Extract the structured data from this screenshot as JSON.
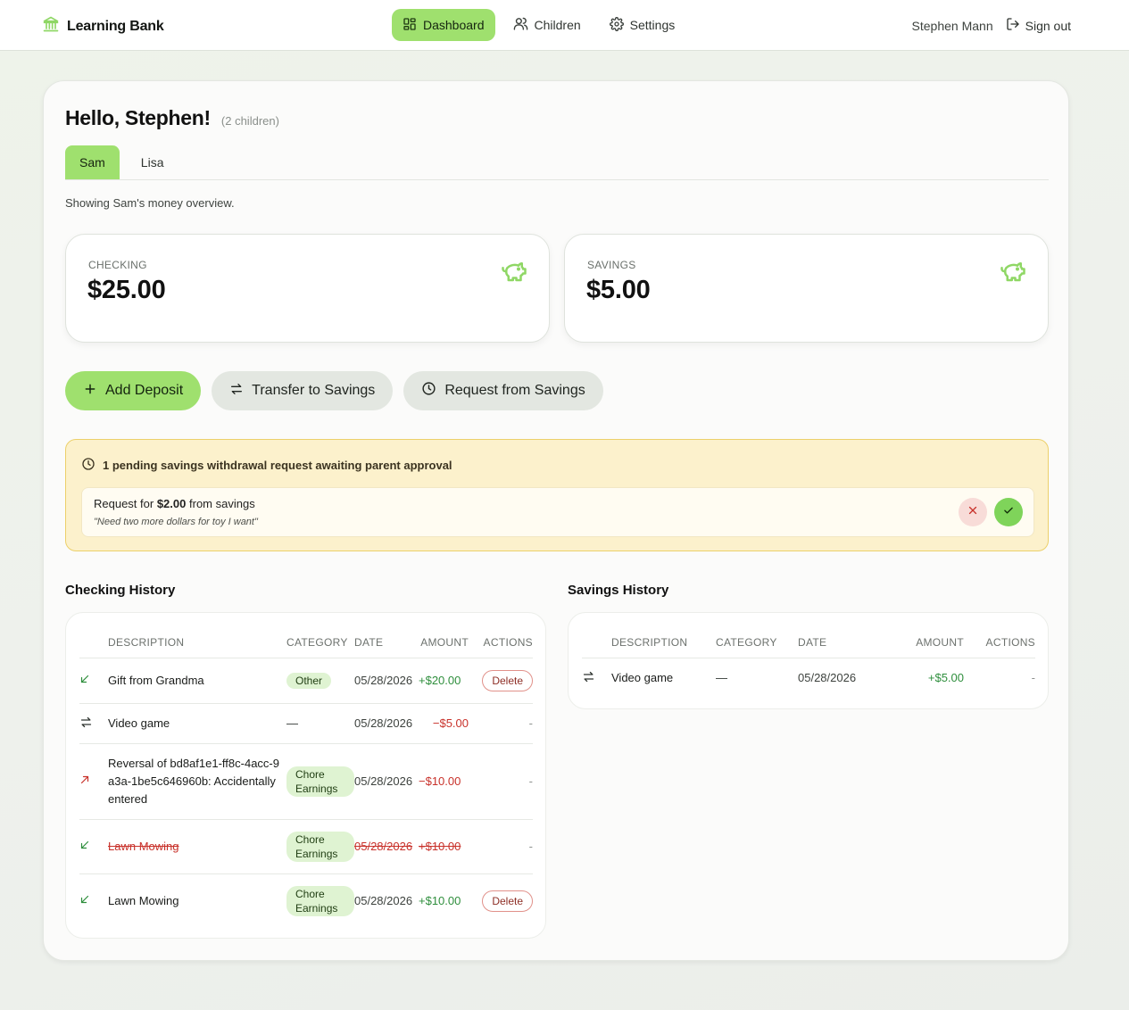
{
  "app": {
    "brand": "Learning Bank"
  },
  "nav": {
    "items": [
      {
        "label": "Dashboard",
        "icon": "dashboard-icon",
        "active": true
      },
      {
        "label": "Children",
        "icon": "users-icon",
        "active": false
      },
      {
        "label": "Settings",
        "icon": "gear-icon",
        "active": false
      }
    ],
    "user_name": "Stephen Mann",
    "sign_out": "Sign out"
  },
  "greeting": {
    "title": "Hello, Stephen!",
    "subtitle": "(2 children)"
  },
  "tabs": [
    {
      "label": "Sam",
      "active": true
    },
    {
      "label": "Lisa",
      "active": false
    }
  ],
  "overview_text": "Showing Sam's money overview.",
  "accounts": {
    "checking": {
      "label": "CHECKING",
      "value": "$25.00",
      "icon": "piggy-bank-icon"
    },
    "savings": {
      "label": "SAVINGS",
      "value": "$5.00",
      "icon": "piggy-bank-icon"
    }
  },
  "actions": {
    "add_deposit": "Add Deposit",
    "transfer": "Transfer to Savings",
    "request": "Request from Savings"
  },
  "pending": {
    "heading": "1 pending savings withdrawal request awaiting parent approval",
    "request": {
      "prefix": "Request for",
      "amount": "$2.00",
      "suffix": "from savings",
      "note": "\"Need two more dollars for toy I want\""
    }
  },
  "checking_history": {
    "title": "Checking History",
    "columns": [
      "DESCRIPTION",
      "CATEGORY",
      "DATE",
      "AMOUNT",
      "ACTIONS"
    ],
    "rows": [
      {
        "icon": "arrow-down-left-icon",
        "description": "Gift from Grandma",
        "category": "Other",
        "date": "05/28/2026",
        "amount": "+$20.00",
        "action": "Delete"
      },
      {
        "icon": "transfer-icon",
        "description": "Video game",
        "category": "—",
        "date": "05/28/2026",
        "amount": "−$5.00",
        "action": "-"
      },
      {
        "icon": "arrow-up-right-icon",
        "description": "Reversal of bd8af1e1-ff8c-4acc-9a3a-1be5c646960b: Accidentally entered",
        "category": "Chore Earnings",
        "date": "05/28/2026",
        "amount": "−$10.00",
        "action": "-"
      },
      {
        "icon": "arrow-down-left-icon",
        "description": "Lawn Mowing",
        "category": "Chore Earnings",
        "date": "05/28/2026",
        "amount": "+$10.00",
        "action": "-"
      },
      {
        "icon": "arrow-down-left-icon",
        "description": "Lawn Mowing",
        "category": "Chore Earnings",
        "date": "05/28/2026",
        "amount": "+$10.00",
        "action": "Delete"
      }
    ]
  },
  "savings_history": {
    "title": "Savings History",
    "columns": [
      "DESCRIPTION",
      "CATEGORY",
      "DATE",
      "AMOUNT",
      "ACTIONS"
    ],
    "rows": [
      {
        "icon": "transfer-icon",
        "description": "Video game",
        "category": "—",
        "date": "05/28/2026",
        "amount": "+$5.00",
        "action": "-"
      }
    ]
  },
  "colors": {
    "accent": "#9fe06e",
    "positive": "#2e8e3c",
    "negative": "#c8312a",
    "pending_bg": "#fcf1cc",
    "pending_border": "#ecd06a"
  }
}
